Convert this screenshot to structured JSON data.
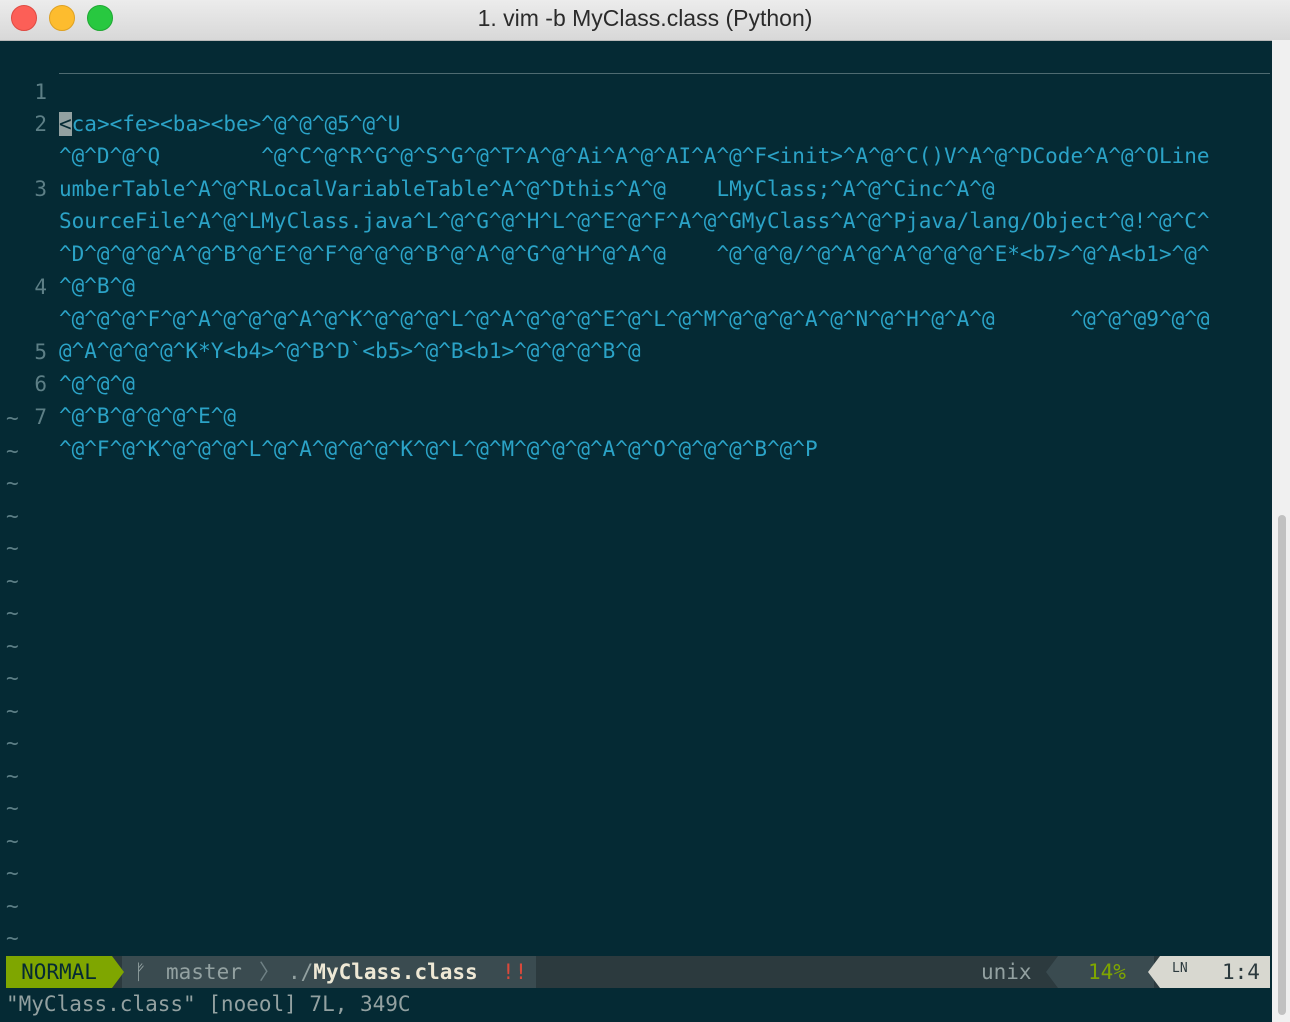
{
  "window": {
    "title": "1. vim -b MyClass.class (Python)"
  },
  "editor": {
    "lines": [
      {
        "num": "1",
        "cursor_char": "<",
        "text": "ca><fe><ba><be>^@^@^@5^@^U"
      },
      {
        "num": "2",
        "text": "^@^D^@^Q        ^@^C^@^R^G^@^S^G^@^T^A^@^Ai^A^@^AI^A^@^F<init>^A^@^C()V^A^@^DCode^A^@^OLine"
      },
      {
        "num": "",
        "text": "umberTable^A^@^RLocalVariableTable^A^@^Dthis^A^@    LMyClass;^A^@^Cinc^A^@"
      },
      {
        "num": "3",
        "text": "SourceFile^A^@^LMyClass.java^L^@^G^@^H^L^@^E^@^F^A^@^GMyClass^A^@^Pjava/lang/Object^@!^@^C^"
      },
      {
        "num": "",
        "text": "^D^@^@^@^A^@^B^@^E^@^F^@^@^@^B^@^A^@^G^@^H^@^A^@    ^@^@^@/^@^A^@^A^@^@^@^E*<b7>^@^A<b1>^@^"
      },
      {
        "num": "",
        "text": "^@^B^@"
      },
      {
        "num": "4",
        "text": "^@^@^@^F^@^A^@^@^@^A^@^K^@^@^@^L^@^A^@^@^@^E^@^L^@^M^@^@^@^A^@^N^@^H^@^A^@      ^@^@^@9^@^@"
      },
      {
        "num": "",
        "text": "@^A^@^@^@^K*Y<b4>^@^B^D`<b5>^@^B<b1>^@^@^@^B^@"
      },
      {
        "num": "5",
        "text": "^@^@^@"
      },
      {
        "num": "6",
        "text": "^@^B^@^@^@^E^@"
      },
      {
        "num": "7",
        "text": "^@^F^@^K^@^@^@^L^@^A^@^@^@^K^@^L^@^M^@^@^@^A^@^O^@^@^@^B^@^P"
      }
    ],
    "tilde": "~"
  },
  "statusline": {
    "mode": "NORMAL",
    "branch_icon": "ᚠ",
    "branch": "master",
    "separator": "〉",
    "file_prefix": "./",
    "file_name": "MyClass.class",
    "modified": "!!",
    "encoding": "unix",
    "percent": "14%",
    "line_icon": "LN",
    "position": "1:4"
  },
  "cmdline": {
    "message": "\"MyClass.class\" [noeol] 7L, 349C"
  },
  "colors": {
    "background": "#052a34",
    "code_text": "#2ba3c7",
    "line_number": "#5d7f86",
    "mode_accent": "#7fa600",
    "modified": "#d9493b"
  }
}
